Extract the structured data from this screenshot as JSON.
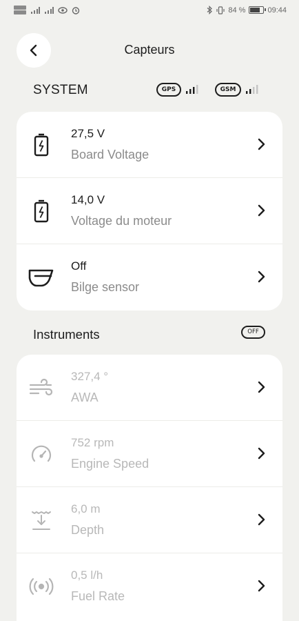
{
  "status_bar": {
    "battery_percent_text": "84 %",
    "battery_level": 0.84,
    "time": "09:44"
  },
  "header": {
    "title": "Capteurs"
  },
  "system": {
    "title": "SYSTEM",
    "gps_label": "GPS",
    "gsm_label": "GSM",
    "gps_signal_bars": 3,
    "gsm_signal_bars": 2,
    "items": [
      {
        "value": "27,5 V",
        "label": "Board Voltage",
        "icon": "battery-charging-icon"
      },
      {
        "value": "14,0 V",
        "label": "Voltage du moteur",
        "icon": "battery-charging-icon"
      },
      {
        "value": "Off",
        "label": "Bilge sensor",
        "icon": "bilge-sensor-icon"
      }
    ]
  },
  "instruments": {
    "title": "Instruments",
    "toggle_label": "OFF",
    "items": [
      {
        "value": "327,4 °",
        "label": "AWA",
        "icon": "wind-icon"
      },
      {
        "value": "752 rpm",
        "label": "Engine Speed",
        "icon": "speedometer-icon"
      },
      {
        "value": "6,0 m",
        "label": "Depth",
        "icon": "depth-icon"
      },
      {
        "value": "0,5 l/h",
        "label": "Fuel Rate",
        "icon": "fuel-rate-icon"
      }
    ]
  },
  "colors": {
    "background": "#f1f1ee",
    "card": "#ffffff",
    "text": "#1d1d1d",
    "muted": "#8b8b8b",
    "disabled": "#b8b8b8"
  }
}
